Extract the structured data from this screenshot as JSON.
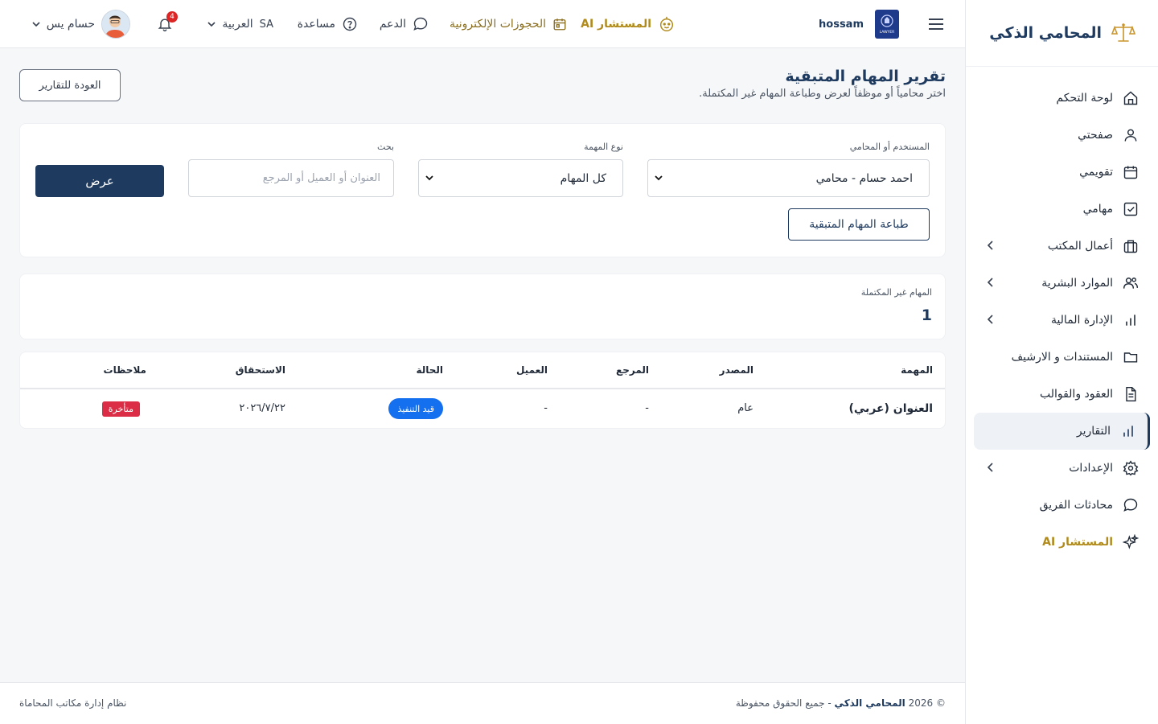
{
  "brand": {
    "name": "المحامي الذكي"
  },
  "sidebar": {
    "items": [
      {
        "label": "لوحة التحكم"
      },
      {
        "label": "صفحتي"
      },
      {
        "label": "تقويمي"
      },
      {
        "label": "مهامي"
      },
      {
        "label": "أعمال المكتب"
      },
      {
        "label": "الموارد البشرية"
      },
      {
        "label": "الإدارة المالية"
      },
      {
        "label": "المستندات و الارشيف"
      },
      {
        "label": "العقود والقوالب"
      },
      {
        "label": "التقارير"
      },
      {
        "label": "الإعدادات"
      },
      {
        "label": "محادثات الفريق"
      },
      {
        "label": "المستشار AI"
      }
    ]
  },
  "header": {
    "username": "hossam",
    "ai_label": "المستشار AI",
    "reservations_label": "الحجوزات الإلكترونية",
    "support_label": "الدعم",
    "help_label": "مساعدة",
    "lang_code": "SA",
    "lang_label": "العربية",
    "notif_count": "4",
    "user_name": "حسام يس",
    "logo_text": "LAWYER"
  },
  "page": {
    "title": "تقرير المهام المتبقية",
    "subtitle": "اختر محامياً أو موظفاً لعرض وطباعة المهام غير المكتملة.",
    "back_label": "العودة للتقارير"
  },
  "filters": {
    "user_label": "المستخدم أو المحامي",
    "user_value": "احمد حسام - محامي",
    "type_label": "نوع المهمة",
    "type_value": "كل المهام",
    "search_label": "بحث",
    "search_placeholder": "العنوان أو العميل أو المرجع",
    "show_label": "عرض",
    "print_label": "طباعة المهام المتبقية"
  },
  "summary": {
    "label": "المهام غير المكتملة",
    "value": "1"
  },
  "table": {
    "headers": [
      "المهمة",
      "المصدر",
      "المرجع",
      "العميل",
      "الحالة",
      "الاستحقاق",
      "ملاحظات"
    ],
    "rows": [
      {
        "task": "العنوان (عربي)",
        "source": "عام",
        "ref": "-",
        "client": "-",
        "status": "قيد التنفيذ",
        "due": "٢٠٢٦/٧/٢٢",
        "notes": "متأخرة"
      }
    ]
  },
  "footer": {
    "copyright_prefix": "© 2026",
    "brand": "المحامي الذكي",
    "rights": "- جميع الحقوق محفوظة",
    "system": "نظام إدارة مكاتب المحاماة"
  },
  "colors": {
    "primary": "#1e3a5f",
    "gold": "#b08a1c",
    "status_blue": "#1570ef",
    "late_red": "#dc2d46"
  }
}
